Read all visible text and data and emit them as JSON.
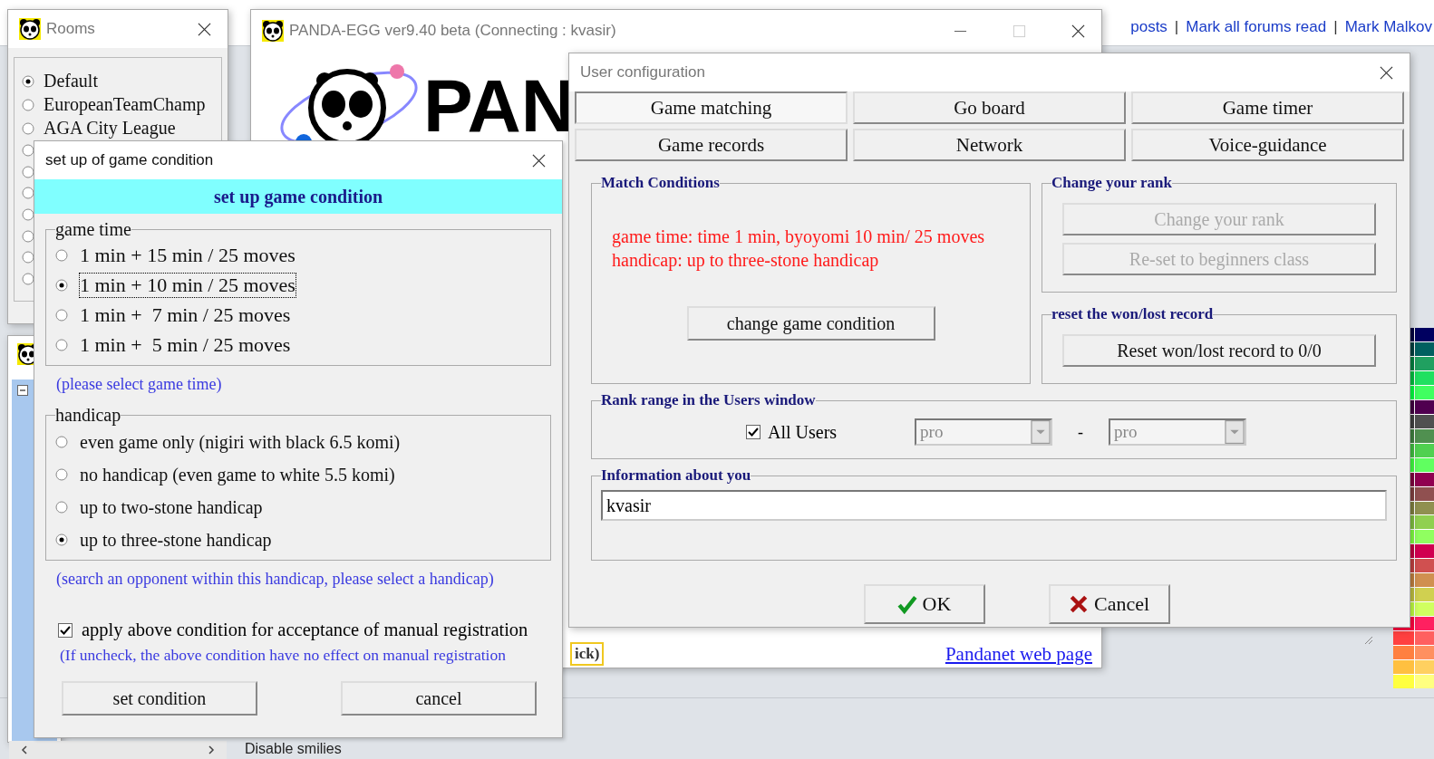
{
  "web_page": {
    "nav": [
      {
        "kind": "link",
        "text": "posts"
      },
      {
        "kind": "sep",
        "text": "|"
      },
      {
        "kind": "link",
        "text": "Mark all forums read"
      },
      {
        "kind": "sep",
        "text": "|"
      },
      {
        "kind": "link",
        "text": "Mark Malkov"
      }
    ],
    "option_label": "Disable smilies"
  },
  "rooms_window": {
    "title": "Rooms",
    "rooms": [
      {
        "label": "Default",
        "selected": true
      },
      {
        "label": "EuropeanTeamChamp",
        "selected": false
      },
      {
        "label": "AGA City League",
        "selected": false
      },
      {
        "selected": false
      },
      {
        "selected": false
      },
      {
        "selected": false
      },
      {
        "selected": false
      },
      {
        "selected": false
      },
      {
        "selected": false
      },
      {
        "selected": false
      }
    ]
  },
  "main_window": {
    "title": "PANDA-EGG ver9.40 beta (Connecting : kvasir)",
    "logo_text": "PAN",
    "hint_fragment": "ick)",
    "link": "Pandanet web page"
  },
  "user_config": {
    "title": "User configuration",
    "tabs": [
      {
        "label": "Game matching",
        "selected": true
      },
      {
        "label": "Go board",
        "selected": false
      },
      {
        "label": "Game timer",
        "selected": false
      },
      {
        "label": "Game records",
        "selected": false
      },
      {
        "label": "Network",
        "selected": false
      },
      {
        "label": "Voice-guidance",
        "selected": false
      }
    ],
    "match_conditions": {
      "legend": "Match Conditions",
      "lines": [
        "game time: time 1 min, byoyomi 10 min/ 25 moves",
        "handicap: up to three-stone handicap"
      ],
      "button": "change game condition"
    },
    "change_rank": {
      "legend": "Change your rank",
      "buttons": [
        {
          "label": "Change your rank",
          "disabled": true
        },
        {
          "label": "Re-set to beginners class",
          "disabled": true
        }
      ]
    },
    "reset_record": {
      "legend": "reset the won/lost record",
      "button": "Reset won/lost record to 0/0"
    },
    "rank_range": {
      "legend": "Rank range in the Users window",
      "all_users": {
        "label": "All Users",
        "checked": true
      },
      "from": {
        "value": "pro",
        "disabled": true
      },
      "separator": "-",
      "to": {
        "value": "pro",
        "disabled": true
      }
    },
    "info": {
      "legend": "Information about you",
      "value": "kvasir"
    },
    "buttons": [
      {
        "kind": "ok",
        "label": "OK"
      },
      {
        "kind": "cancel",
        "label": "Cancel"
      }
    ]
  },
  "condition_dialog": {
    "title": "set up of game condition",
    "header": "set up game condition",
    "game_time": {
      "legend": "game time",
      "options": [
        {
          "label": "1 min + 15 min / 25 moves",
          "selected": false,
          "focused": false
        },
        {
          "label": "1 min + 10 min / 25 moves",
          "selected": true,
          "focused": true
        },
        {
          "label": "1 min +  7 min / 25 moves",
          "selected": false,
          "focused": false
        },
        {
          "label": "1 min +  5 min / 25 moves",
          "selected": false,
          "focused": false
        }
      ]
    },
    "game_time_hint": "(please select game time)",
    "handicap": {
      "legend": "handicap",
      "options": [
        {
          "label": "even game only (nigiri with black 6.5 komi)",
          "selected": false
        },
        {
          "label": "no handicap (even game to white 5.5 komi)",
          "selected": false
        },
        {
          "label": "up to two-stone handicap",
          "selected": false
        },
        {
          "label": "up to three-stone handicap",
          "selected": true
        }
      ]
    },
    "handicap_hint": "(search an opponent within this handicap, please select a handicap)",
    "apply": {
      "label": "apply above condition for acceptance of manual registration",
      "checked": true
    },
    "apply_hint": "(If uncheck, the above condition have no effect on manual registration",
    "buttons": [
      "set condition",
      "cancel"
    ]
  }
}
